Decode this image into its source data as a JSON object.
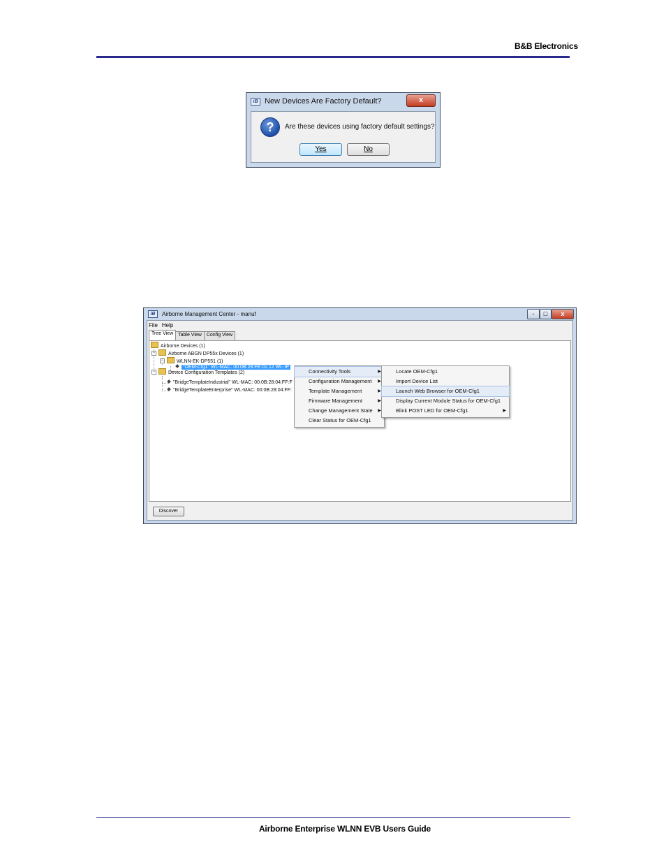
{
  "page": {
    "header_brand": "B&B Electronics",
    "footer_title": "Airborne Enterprise WLNN EVB Users Guide"
  },
  "dialog": {
    "title": "New Devices Are Factory Default?",
    "logo": "iB",
    "close": "x",
    "message": "Are these devices using factory default settings?",
    "yes_label": "Yes",
    "no_label": "No"
  },
  "app": {
    "title": "Airborne Management Center - manuf",
    "logo": "iB",
    "controls": {
      "minimize": "-",
      "maximize": "□",
      "close": "x"
    },
    "menu": [
      "File",
      "Help"
    ],
    "tabs": [
      "Tree View",
      "Table View",
      "Config View"
    ],
    "tree": {
      "root": "Airborne Devices (1)",
      "group": "Airborne ABGN DP55x Devices (1)",
      "model": "WLNN-EK-DP551 (1)",
      "device_selected": "\"OEM-Cfg1\"   WL-MAC: 00:0B:28:FE:01:12   WL-IP",
      "templates": "Device Configuration Templates (2)",
      "template1": "\"BridgeTemplateIndustrial\"   WL-MAC: 00:0B:28:04:FF:F",
      "template2": "\"BridgeTemplateEnterprise\"   WL-MAC: 00:0B:28:04:FF:"
    },
    "context_menu": [
      "Connectivity Tools",
      "Configuration Management",
      "Template Management",
      "Firmware Management",
      "Change Management State",
      "Clear Status for OEM-Cfg1"
    ],
    "submenu": [
      "Locate OEM-Cfg1",
      "Import Device List",
      "Launch Web Browser for OEM-Cfg1",
      "Display Current Module Status for OEM-Cfg1",
      "Blink POST LED for OEM-Cfg1"
    ],
    "discover_label": "Discover"
  }
}
